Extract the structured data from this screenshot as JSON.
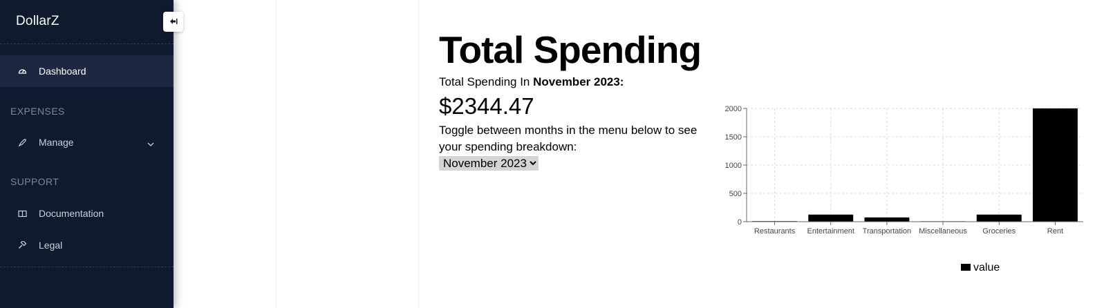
{
  "brand": "DollarZ",
  "sidebar": {
    "items": [
      {
        "label": "Dashboard",
        "icon": "gauge-icon"
      },
      {
        "label": "Manage",
        "icon": "rocket-icon"
      },
      {
        "label": "Documentation",
        "icon": "book-icon"
      },
      {
        "label": "Legal",
        "icon": "gavel-icon"
      }
    ],
    "sections": {
      "expenses": "EXPENSES",
      "support": "SUPPORT"
    }
  },
  "main": {
    "title": "Total Spending",
    "subtitle_prefix": "Total Spending In",
    "subtitle_month": "November 2023:",
    "amount": "$2344.47",
    "toggle_text": "Toggle between months in the menu below to see your spending breakdown:",
    "select": {
      "selected": "November 2023",
      "options": [
        "November 2023"
      ]
    }
  },
  "chart_data": {
    "type": "bar",
    "categories": [
      "Restaurants",
      "Entertainment",
      "Transportation",
      "Miscellaneous",
      "Groceries",
      "Rent"
    ],
    "values": [
      10,
      125,
      75,
      8,
      125,
      2000
    ],
    "ylim": [
      0,
      2000
    ],
    "yticks": [
      0,
      500,
      1000,
      1500,
      2000
    ],
    "legend": [
      "value"
    ],
    "legend_position": "bottom-right",
    "grid": true,
    "bar_color": "#000000"
  },
  "colors": {
    "sidebar_bg": "#101a2e",
    "active_item_bg": "#1d2840"
  }
}
